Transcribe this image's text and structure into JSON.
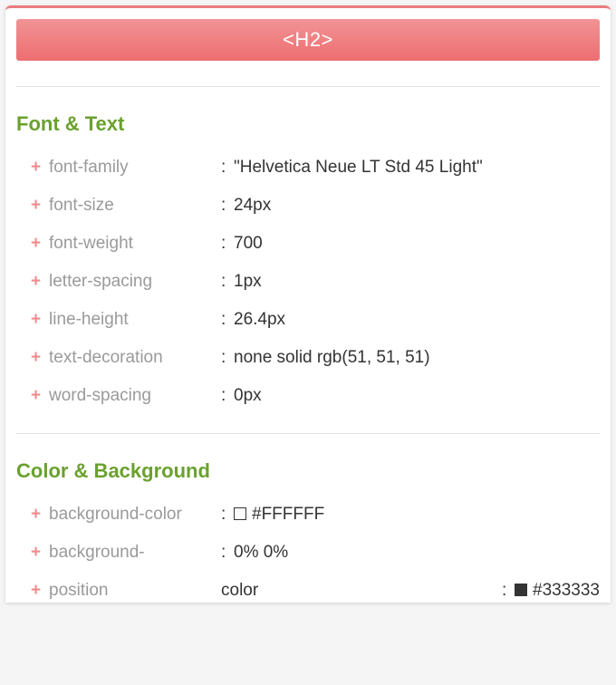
{
  "header": {
    "title": "<H2>"
  },
  "sections": {
    "font_text": {
      "title": "Font & Text",
      "props": [
        {
          "plus": "+",
          "name": "font-family",
          "value": "\"Helvetica Neue LT Std 45 Light\""
        },
        {
          "plus": "+",
          "name": "font-size",
          "value": "24px"
        },
        {
          "plus": "+",
          "name": "font-weight",
          "value": "700"
        },
        {
          "plus": "+",
          "name": "letter-spacing",
          "value": "1px"
        },
        {
          "plus": "+",
          "name": "line-height",
          "value": "26.4px"
        },
        {
          "plus": "+",
          "name": "text-decoration",
          "value": "none solid rgb(51, 51, 51)"
        },
        {
          "plus": "+",
          "name": "word-spacing",
          "value": "0px"
        }
      ]
    },
    "color_bg": {
      "title": "Color & Background",
      "props": [
        {
          "plus": "+",
          "name": "background-color",
          "swatch": "white",
          "value": "#FFFFFF"
        },
        {
          "plus": "+",
          "name": "background-",
          "value": "0% 0%"
        }
      ],
      "overflow_row": {
        "plus": "+",
        "position_text": "position",
        "color_label": "color",
        "colon": ":",
        "swatch": "dark",
        "value": "#333333"
      }
    }
  }
}
